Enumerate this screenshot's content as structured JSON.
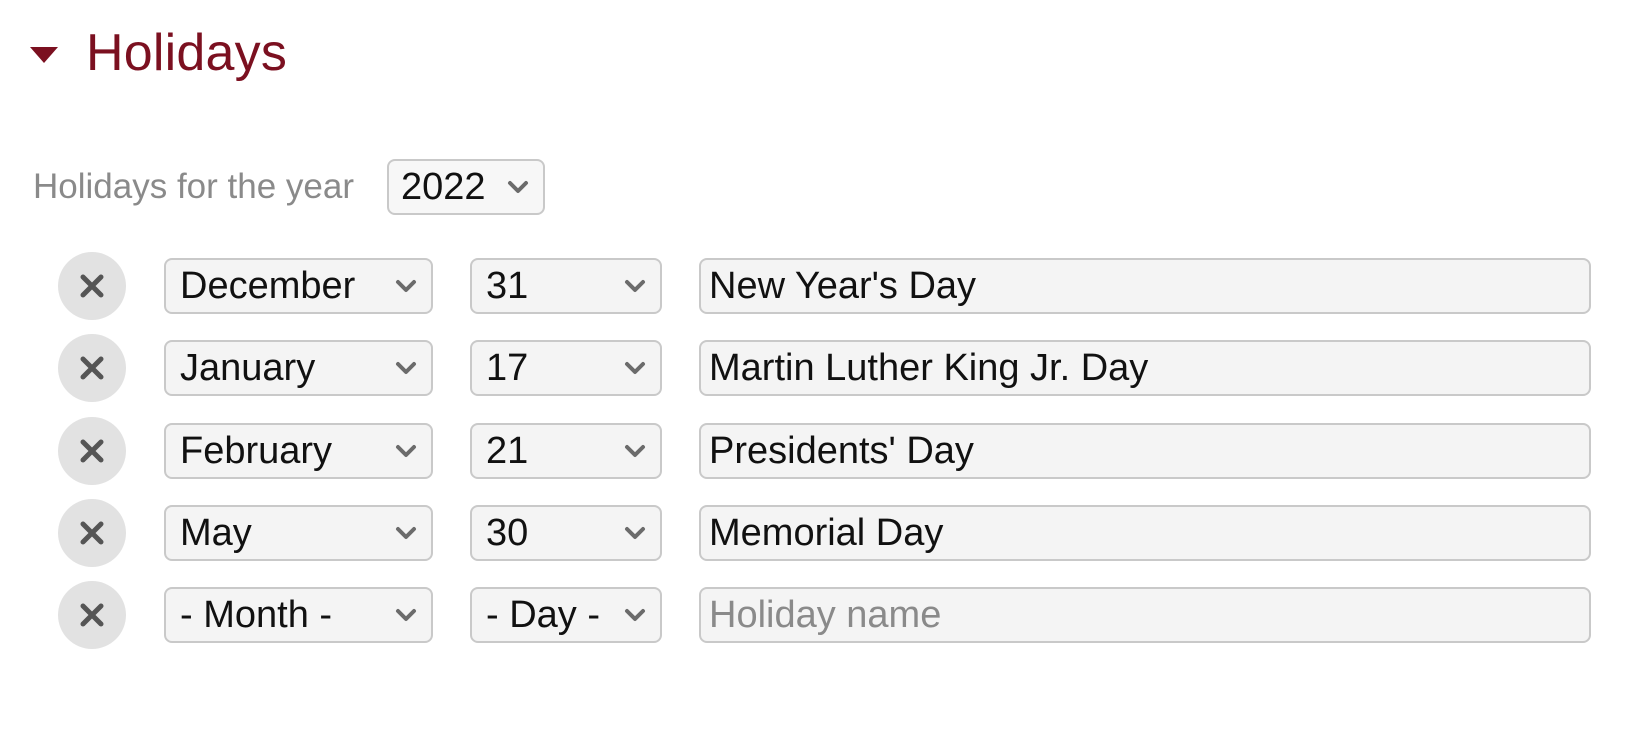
{
  "section": {
    "title": "Holidays",
    "accent_color": "#7b1020"
  },
  "year": {
    "label": "Holidays for the year",
    "selected": "2022"
  },
  "holidays": [
    {
      "month": "December",
      "day": "31",
      "name": "New Year's Day",
      "placeholder": ""
    },
    {
      "month": "January",
      "day": "17",
      "name": "Martin Luther King Jr. Day",
      "placeholder": ""
    },
    {
      "month": "February",
      "day": "21",
      "name": "Presidents' Day",
      "placeholder": ""
    },
    {
      "month": "May",
      "day": "30",
      "name": "Memorial Day",
      "placeholder": ""
    },
    {
      "month": "- Month -",
      "day": "- Day -",
      "name": "",
      "placeholder": "Holiday name"
    }
  ],
  "icons": {
    "collapse": "caret-down-icon",
    "remove": "close-icon",
    "dropdown": "chevron-down-icon"
  }
}
